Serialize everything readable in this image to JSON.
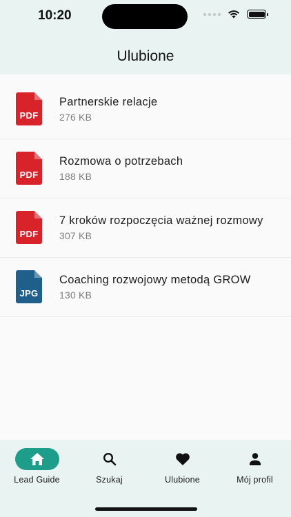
{
  "status": {
    "time": "10:20"
  },
  "header": {
    "title": "Ulubione"
  },
  "files": [
    {
      "name": "Partnerskie relacje",
      "size": "276 KB",
      "type": "PDF",
      "color": "#d8232a"
    },
    {
      "name": "Rozmowa o potrzebach",
      "size": "188 KB",
      "type": "PDF",
      "color": "#d8232a"
    },
    {
      "name": "7 kroków rozpoczęcia ważnej rozmowy",
      "size": "307 KB",
      "type": "PDF",
      "color": "#d8232a"
    },
    {
      "name": "Coaching rozwojowy metodą GROW",
      "size": "130 KB",
      "type": "JPG",
      "color": "#1f5f8c"
    }
  ],
  "tabs": [
    {
      "label": "Lead Guide",
      "icon": "home-icon",
      "active": true
    },
    {
      "label": "Szukaj",
      "icon": "search-icon",
      "active": false
    },
    {
      "label": "Ulubione",
      "icon": "heart-icon",
      "active": false
    },
    {
      "label": "Mój profil",
      "icon": "person-icon",
      "active": false
    }
  ],
  "colors": {
    "accent": "#1e9e8a",
    "header_bg": "#e9f3f1"
  }
}
